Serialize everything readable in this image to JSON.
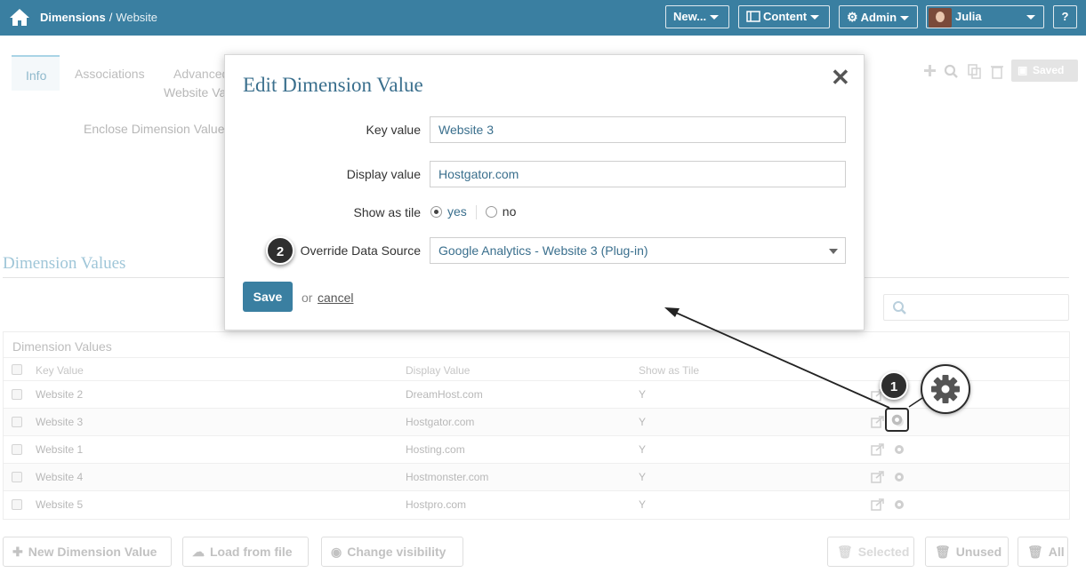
{
  "topbar": {
    "breadcrumb_root": "Dimensions",
    "breadcrumb_sep": "/",
    "breadcrumb_leaf": "Website",
    "new_label": "New...",
    "content_label": "Content",
    "admin_label": "Admin",
    "user_name": "Julia",
    "help_label": "?"
  },
  "tabs": [
    {
      "label": "Info",
      "active": true
    },
    {
      "label": "Associations"
    },
    {
      "label": "Advanced"
    }
  ],
  "toolbar": {
    "saved_label": "Saved"
  },
  "background": {
    "label_partial_top": "Website Va",
    "label_enclose": "Enclose Dimension Value",
    "section_title": "Dimension Values"
  },
  "grid": {
    "caption": "Dimension Values",
    "headers": [
      "Key Value",
      "Display Value",
      "Show as Tile"
    ],
    "rows": [
      {
        "key": "Website 2",
        "display": "DreamHost.com",
        "tile": "Y"
      },
      {
        "key": "Website 3",
        "display": "Hostgator.com",
        "tile": "Y"
      },
      {
        "key": "Website 1",
        "display": "Hosting.com",
        "tile": "Y"
      },
      {
        "key": "Website 4",
        "display": "Hostmonster.com",
        "tile": "Y"
      },
      {
        "key": "Website 5",
        "display": "Hostpro.com",
        "tile": "Y"
      }
    ]
  },
  "bottom_buttons": {
    "new_value": "New Dimension Value",
    "load_file": "Load from file",
    "change_visibility": "Change visibility",
    "selected": "Selected",
    "unused": "Unused",
    "all": "All"
  },
  "modal": {
    "title": "Edit Dimension Value",
    "close_label": "✕",
    "key_label": "Key value",
    "key_value": "Website 3",
    "display_label": "Display value",
    "display_value": "Hostgator.com",
    "tile_label": "Show as tile",
    "tile_yes": "yes",
    "tile_no": "no",
    "source_label": "Override Data Source",
    "source_value": "Google Analytics - Website 3 (Plug-in)",
    "save_label": "Save",
    "or_text": "or",
    "cancel_label": "cancel"
  },
  "callouts": {
    "step1": "1",
    "step2": "2"
  },
  "colors": {
    "topbar": "#3a7fa1",
    "accent_text": "#3a6f8d",
    "save_button": "#3a7fa1",
    "callout_badge": "#2f2f2f"
  }
}
